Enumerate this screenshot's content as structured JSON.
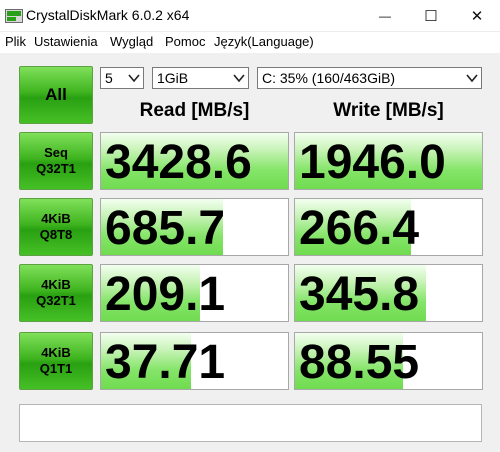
{
  "window": {
    "title": "CrystalDiskMark 6.0.2 x64",
    "minimize_glyph": "—",
    "maximize_glyph": "☐",
    "close_glyph": "✕"
  },
  "menu": [
    "Plik",
    "Ustawienia",
    "Wygląd",
    "Pomoc",
    "Język(Language)"
  ],
  "controls": {
    "all_button": "All",
    "count": "5",
    "size": "1GiB",
    "drive": "C: 35% (160/463GiB)"
  },
  "headers": {
    "read": "Read [MB/s]",
    "write": "Write [MB/s]"
  },
  "tests": [
    {
      "line1": "Seq",
      "line2": "Q32T1",
      "read": "3428.6",
      "write": "1946.0",
      "read_fill": 1.0,
      "write_fill": 1.0
    },
    {
      "line1": "4KiB",
      "line2": "Q8T8",
      "read": "685.7",
      "write": "266.4",
      "read_fill": 0.65,
      "write_fill": 0.62
    },
    {
      "line1": "4KiB",
      "line2": "Q32T1",
      "read": "209.1",
      "write": "345.8",
      "read_fill": 0.53,
      "write_fill": 0.7
    },
    {
      "line1": "4KiB",
      "line2": "Q1T1",
      "read": "37.71",
      "write": "88.55",
      "read_fill": 0.48,
      "write_fill": 0.58
    }
  ],
  "comment": "",
  "colors": {
    "button_green": "#3fb41f",
    "bar_green": "#86e56a",
    "background": "#f0f0f0"
  }
}
